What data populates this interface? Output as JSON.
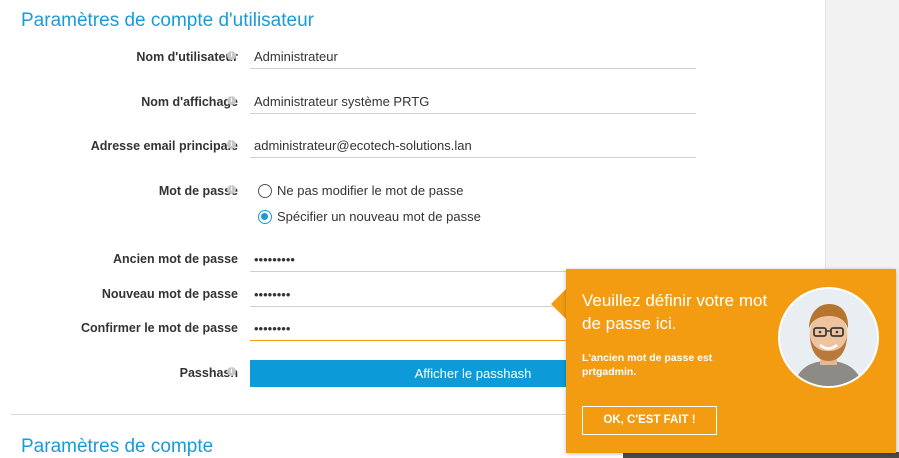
{
  "section_user": {
    "title": "Paramètres de compte d'utilisateur"
  },
  "fields": [
    {
      "label": "Nom d'utilisateur",
      "value": "Administrateur"
    },
    {
      "label": "Nom d'affichage",
      "value": "Administrateur système PRTG"
    },
    {
      "label": "Adresse email principale",
      "value": "administrateur@ecotech-solutions.lan"
    }
  ],
  "password": {
    "label": "Mot de passe",
    "options": [
      {
        "label": "Ne pas modifier le mot de passe",
        "checked": false
      },
      {
        "label": "Spécifier un nouveau mot de passe",
        "checked": true
      }
    ],
    "old_label": "Ancien mot de passe",
    "old_value": "•••••••••",
    "new_label": "Nouveau mot de passe",
    "new_value": "••••••••",
    "confirm_label": "Confirmer le mot de passe",
    "confirm_value": "••••••••"
  },
  "passhash": {
    "label": "Passhash",
    "button": "Afficher le passhash"
  },
  "section_account": {
    "title": "Paramètres de compte"
  },
  "tooltip": {
    "title": "Veuillez définir votre mot de passe ici.",
    "text": "L'ancien mot de passe est prtgadmin.",
    "button": "OK, C'EST FAIT !"
  },
  "colors": {
    "accent": "#1a9bd7",
    "tooltip": "#f39c12",
    "button": "#0d9ad8"
  },
  "icons": {
    "info": "info-icon",
    "avatar": "avatar-photo"
  }
}
